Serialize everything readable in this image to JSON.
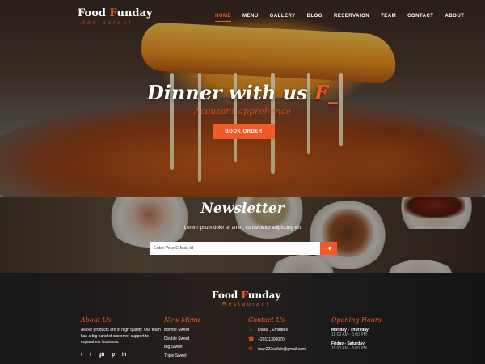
{
  "brand": {
    "name_lead": "Food ",
    "name_accent": "F",
    "name_tail": "unday",
    "tagline": "Restaurant"
  },
  "nav": {
    "items": [
      "Home",
      "Menu",
      "Gallery",
      "Blog",
      "Reservaion",
      "Team",
      "Contact",
      "About"
    ],
    "active": "Home"
  },
  "hero": {
    "title": "Dinner with us ",
    "title_accent": "F_",
    "subtitle": "Accusant apprehence",
    "button": "BOOK ORDER"
  },
  "newsletter": {
    "title": "Newsletter",
    "text": "Lorem ipsum dolor sit amet, consectetur adipiscing elit",
    "placeholder": "Enter Your E-Mail Id",
    "send_icon": "paper-plane-icon"
  },
  "footer": {
    "about": {
      "heading": "About Us",
      "text": "All our products are of high quality. Our team has a big hand of customer support to expand our business.",
      "social": [
        "f",
        "t",
        "gh",
        "p",
        "in"
      ]
    },
    "menu": {
      "heading": "New Menu",
      "items": [
        "Bombe Sweet",
        "Double Sweet",
        "Big Sweet",
        "Triple Sweet"
      ]
    },
    "contact": {
      "heading": "Contact Us",
      "address": "Dubai , Emirates",
      "phone": "+20111393070",
      "email": "mah222sallah@gmail.com"
    },
    "hours": {
      "heading": "Opening Hours",
      "entries": [
        {
          "day": "Monday - Thursday",
          "time": "11:00 AM - 5:00 PM"
        },
        {
          "day": "Friday - Saturday",
          "time": "11:00 AM - 3:00 PM"
        }
      ]
    }
  },
  "colors": {
    "accent": "#f05a28"
  }
}
